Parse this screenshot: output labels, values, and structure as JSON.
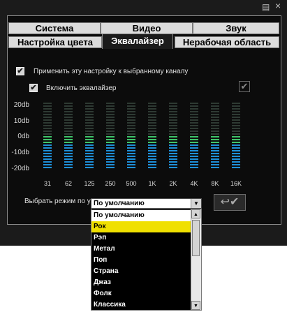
{
  "titlebar": {
    "doc_icon": "▤",
    "close_label": "×"
  },
  "tabs_row1": [
    {
      "label": "Система"
    },
    {
      "label": "Видео"
    },
    {
      "label": "Звук"
    }
  ],
  "tabs_row2": [
    {
      "label": "Настройка цвета"
    },
    {
      "label": "Эквалайзер"
    },
    {
      "label": "Нерабочая область"
    }
  ],
  "apply_channel": {
    "label": "Применить эту настройку к выбранному каналу",
    "checked": true
  },
  "enable_eq": {
    "label": "Включить эквалайзер",
    "checked": true
  },
  "db_labels": [
    "20db",
    "10db",
    "0db",
    "-10db",
    "-20db"
  ],
  "bands": [
    {
      "freq": "31",
      "level_db": 0
    },
    {
      "freq": "62",
      "level_db": 0
    },
    {
      "freq": "125",
      "level_db": 0
    },
    {
      "freq": "250",
      "level_db": 0
    },
    {
      "freq": "500",
      "level_db": 0
    },
    {
      "freq": "1K",
      "level_db": 0
    },
    {
      "freq": "2K",
      "level_db": 0
    },
    {
      "freq": "4K",
      "level_db": 0
    },
    {
      "freq": "8K",
      "level_db": 0
    },
    {
      "freq": "16K",
      "level_db": 0
    }
  ],
  "mode": {
    "label": "Выбрать режим по у",
    "selected": "По умолчанию",
    "options": [
      "По умолчанию",
      "Рок",
      "Рэп",
      "Метал",
      "Поп",
      "Страна",
      "Джаз",
      "Фолк",
      "Классика"
    ],
    "highlighted_index": 1
  },
  "colors": {
    "accent": "#f0e000",
    "eq_low": "#1e90d8",
    "eq_mid": "#3fc46a",
    "eq_off": "#2e3a33"
  }
}
